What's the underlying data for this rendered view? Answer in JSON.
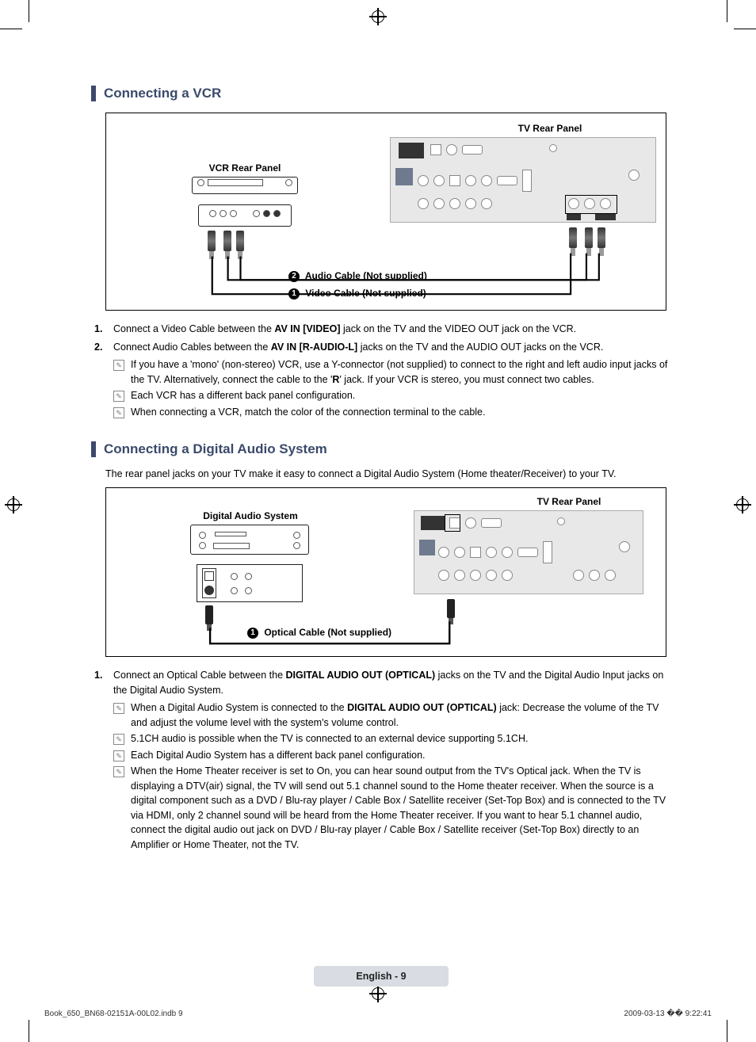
{
  "section1": {
    "title": "Connecting a VCR",
    "diagram": {
      "tv_label": "TV Rear Panel",
      "vcr_label": "VCR Rear Panel",
      "cable2_badge": "2",
      "cable2_label": "Audio Cable (Not supplied)",
      "cable1_badge": "1",
      "cable1_label": "Video Cable (Not supplied)"
    },
    "steps": [
      {
        "num": "1.",
        "pre": "Connect a Video Cable between the ",
        "bold": "AV IN [VIDEO]",
        "post": " jack on the TV and the VIDEO OUT jack on the VCR."
      },
      {
        "num": "2.",
        "pre": "Connect Audio Cables between the ",
        "bold": "AV IN [R-AUDIO-L]",
        "post": " jacks on the TV and the AUDIO OUT jacks on the VCR."
      }
    ],
    "notes": [
      {
        "pre": "If you have a 'mono' (non-stereo) VCR, use a Y-connector (not supplied) to connect to the right and left audio input jacks of the TV. Alternatively, connect the cable to the '",
        "bold": "R",
        "post": "' jack. If your VCR is stereo, you must connect two cables."
      },
      {
        "text": "Each VCR has a different back panel configuration."
      },
      {
        "text": "When connecting a VCR, match the color of the connection terminal to the cable."
      }
    ]
  },
  "section2": {
    "title": "Connecting a Digital Audio System",
    "intro": "The rear panel jacks on your TV make it easy to connect a Digital Audio System (Home theater/Receiver) to your TV.",
    "diagram": {
      "tv_label": "TV Rear Panel",
      "das_label": "Digital Audio System",
      "cable1_badge": "1",
      "cable1_label": "Optical Cable (Not supplied)"
    },
    "steps": [
      {
        "num": "1.",
        "pre": "Connect an Optical Cable between the ",
        "bold": "DIGITAL AUDIO OUT (OPTICAL)",
        "post": " jacks on the TV and the Digital Audio Input jacks on the Digital Audio System."
      }
    ],
    "notes": [
      {
        "pre": "When a Digital Audio System is connected to the ",
        "bold": "DIGITAL AUDIO OUT (OPTICAL)",
        "post": " jack: Decrease the volume of the TV and adjust the volume level with the system's volume control."
      },
      {
        "text": "5.1CH audio is possible when the TV is connected to an external device supporting 5.1CH."
      },
      {
        "text": "Each Digital Audio System has a different back panel configuration."
      },
      {
        "text": "When the Home Theater receiver is set to On, you can hear sound output from the TV's Optical jack. When the TV is displaying a DTV(air) signal, the TV will send out 5.1 channel sound to the Home theater receiver. When the source is a digital component such as a DVD / Blu-ray player / Cable Box / Satellite receiver (Set-Top Box) and is connected to the TV via HDMI, only 2 channel sound will be heard from the Home Theater receiver. If you want to hear 5.1 channel audio, connect the digital audio out jack on DVD / Blu-ray player / Cable Box / Satellite receiver (Set-Top Box) directly to an Amplifier or Home Theater, not the TV."
      }
    ]
  },
  "footer": {
    "page_label": "English - 9",
    "book_id": "Book_650_BN68-02151A-00L02.indb   9",
    "timestamp": "2009-03-13   �� 9:22:41"
  }
}
